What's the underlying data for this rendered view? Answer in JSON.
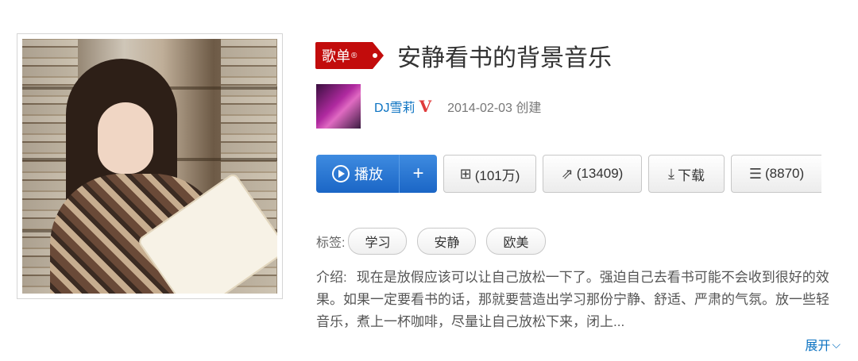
{
  "playlist": {
    "badge_label": "歌单",
    "badge_mark": "®",
    "title": "安静看书的背景音乐"
  },
  "creator": {
    "name": "DJ雪莉",
    "verified_mark": "V",
    "created_at": "2014-02-03 创建"
  },
  "actions": {
    "play_label": "播放",
    "add_label": "+",
    "favorite_count": "(101万)",
    "share_count": "(13409)",
    "download_label": "下载",
    "comment_count": "(8870)"
  },
  "tags": {
    "label": "标签:",
    "items": [
      "学习",
      "安静",
      "欧美"
    ]
  },
  "intro": {
    "label": "介绍:",
    "text": "现在是放假应该可以让自己放松一下了。强迫自己去看书可能不会收到很好的效果。如果一定要看书的话，那就要营造出学习那份宁静、舒适、严肃的气氛。放一些轻音乐，煮上一杯咖啡，尽量让自己放松下来，闭上...",
    "expand_label": "展开"
  },
  "colors": {
    "brand_red": "#c20c0c",
    "link_blue": "#0c73c2",
    "play_blue": "#2a74d0"
  }
}
